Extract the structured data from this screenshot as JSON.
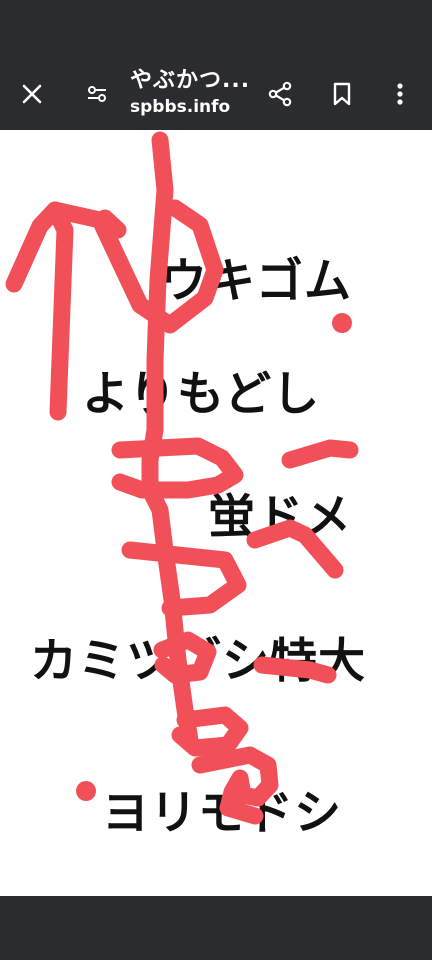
{
  "toolbar": {
    "title": "やぶかつ...",
    "domain": "spbbs.info",
    "icons": [
      "close-icon",
      "page-info-icon",
      "share-icon",
      "bookmark-icon",
      "more-vert-icon"
    ]
  },
  "content": {
    "lines": [
      "ウキゴム",
      "よりもどし",
      "蛍ドメ",
      "カミツブシ特大",
      "ヨリモドシ"
    ],
    "scribble_color": "#f25058"
  }
}
